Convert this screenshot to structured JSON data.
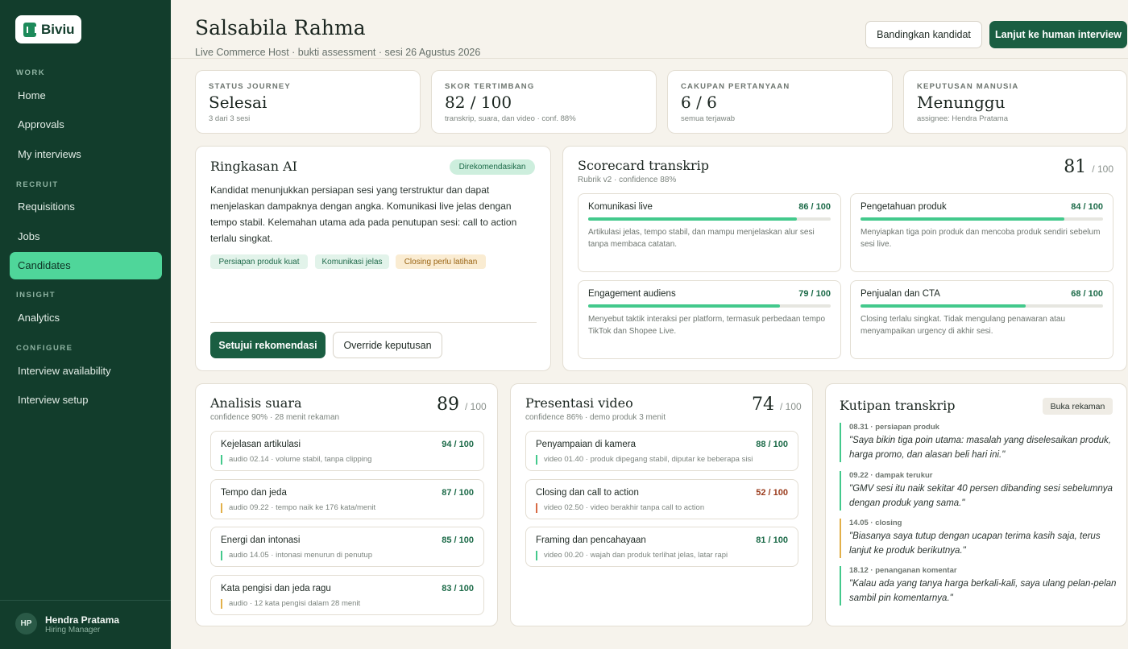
{
  "app": {
    "brand": "Biviu"
  },
  "sidebar": {
    "sections": [
      "WORK",
      "RECRUIT",
      "INSIGHT",
      "CONFIGURE"
    ],
    "items": [
      {
        "label": "Home"
      },
      {
        "label": "Approvals"
      },
      {
        "label": "My interviews"
      },
      {
        "label": "Requisitions"
      },
      {
        "label": "Jobs"
      },
      {
        "label": "Candidates"
      },
      {
        "label": "Analytics"
      },
      {
        "label": "Interview availability"
      },
      {
        "label": "Interview setup"
      }
    ],
    "active": "Candidates",
    "user": {
      "initials": "HP",
      "name": "Hendra Pratama",
      "role": "Hiring Manager"
    }
  },
  "header": {
    "title": "Salsabila Rahma",
    "subtitle": "Live Commerce Host · bukti assessment · sesi 26 Agustus 2026",
    "compare_label": "Bandingkan kandidat",
    "proceed_label": "Lanjut ke human interview"
  },
  "stats": [
    {
      "label": "STATUS JOURNEY",
      "value": "Selesai",
      "sub": "3 dari 3 sesi"
    },
    {
      "label": "SKOR TERTIMBANG",
      "value": "82 / 100",
      "sub": "transkrip, suara, dan video · conf. 88%"
    },
    {
      "label": "CAKUPAN PERTANYAAN",
      "value": "6 / 6",
      "sub": "semua terjawab"
    },
    {
      "label": "KEPUTUSAN MANUSIA",
      "value": "Menunggu",
      "sub": "assignee: Hendra Pratama"
    }
  ],
  "summary": {
    "title": "Ringkasan AI",
    "badge": "Direkomendasikan",
    "text": "Kandidat menunjukkan persiapan sesi yang terstruktur dan dapat menjelaskan dampaknya dengan angka. Komunikasi live jelas dengan tempo stabil. Kelemahan utama ada pada penutupan sesi: call to action terlalu singkat.",
    "tags": [
      "Persiapan produk kuat",
      "Komunikasi jelas",
      "Closing perlu latihan"
    ],
    "approve_label": "Setujui rekomendasi",
    "override_label": "Override keputusan"
  },
  "scorecard": {
    "title": "Scorecard transkrip",
    "sub": "Rubrik v2 · confidence 88%",
    "score": "81",
    "denominator": "/ 100",
    "items": [
      {
        "name": "Komunikasi live",
        "score_label": "86 / 100",
        "value": 86,
        "desc": "Artikulasi jelas, tempo stabil, dan mampu menjelaskan alur sesi tanpa membaca catatan."
      },
      {
        "name": "Pengetahuan produk",
        "score_label": "84 / 100",
        "value": 84,
        "desc": "Menyiapkan tiga poin produk dan mencoba produk sendiri sebelum sesi live."
      },
      {
        "name": "Engagement audiens",
        "score_label": "79 / 100",
        "value": 79,
        "desc": "Menyebut taktik interaksi per platform, termasuk perbedaan tempo TikTok dan Shopee Live."
      },
      {
        "name": "Penjualan dan CTA",
        "score_label": "68 / 100",
        "value": 68,
        "desc": "Closing terlalu singkat. Tidak mengulang penawaran atau menyampaikan urgency di akhir sesi."
      }
    ]
  },
  "voice": {
    "title": "Analisis suara",
    "sub": "confidence 90% · 28 menit rekaman",
    "score": "89",
    "denominator": "/ 100",
    "items": [
      {
        "name": "Kejelasan artikulasi",
        "score": "94 / 100",
        "note": "audio 02.14 · volume stabil, tanpa clipping"
      },
      {
        "name": "Tempo dan jeda",
        "score": "87 / 100",
        "note": "audio 09.22 · tempo naik ke 176 kata/menit"
      },
      {
        "name": "Energi dan intonasi",
        "score": "85 / 100",
        "note": "audio 14.05 · intonasi menurun di penutup"
      },
      {
        "name": "Kata pengisi dan jeda ragu",
        "score": "83 / 100",
        "note": "audio · 12 kata pengisi dalam 28 menit"
      }
    ]
  },
  "video": {
    "title": "Presentasi video",
    "sub": "confidence 86% · demo produk 3 menit",
    "score": "74",
    "denominator": "/ 100",
    "items": [
      {
        "name": "Penyampaian di kamera",
        "score": "88 / 100",
        "note": "video 01.40 · produk dipegang stabil, diputar ke beberapa sisi"
      },
      {
        "name": "Closing dan call to action",
        "score": "52 / 100",
        "note": "video 02.50 · video berakhir tanpa call to action"
      },
      {
        "name": "Framing dan pencahayaan",
        "score": "81 / 100",
        "note": "video 00.20 · wajah dan produk terlihat jelas, latar rapi"
      }
    ]
  },
  "quotes": {
    "title": "Kutipan transkrip",
    "open_label": "Buka rekaman",
    "items": [
      {
        "meta": "08.31 · persiapan produk",
        "text": "\"Saya bikin tiga poin utama: masalah yang diselesaikan produk, harga promo, dan alasan beli hari ini.\""
      },
      {
        "meta": "09.22 · dampak terukur",
        "text": "\"GMV sesi itu naik sekitar 40 persen dibanding sesi sebelumnya dengan produk yang sama.\""
      },
      {
        "meta": "14.05 · closing",
        "text": "\"Biasanya saya tutup dengan ucapan terima kasih saja, terus lanjut ke produk berikutnya.\""
      },
      {
        "meta": "18.12 · penanganan komentar",
        "text": "\"Kalau ada yang tanya harga berkali-kali, saya ulang pelan-pelan sambil pin komentarnya.\""
      }
    ]
  }
}
